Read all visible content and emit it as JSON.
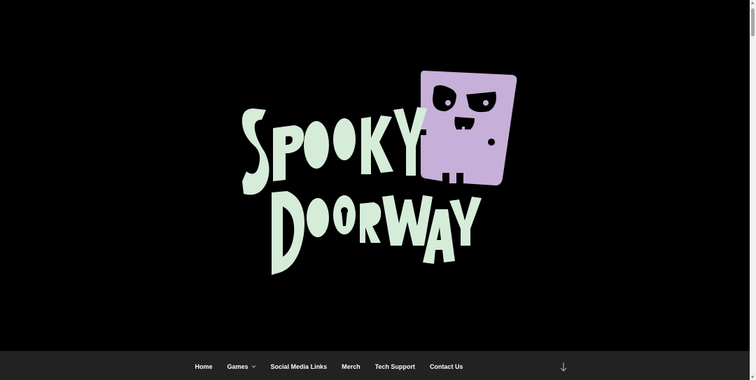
{
  "hero": {
    "logo": {
      "line1": "SPOOKY",
      "line2": "DOORWAY",
      "text_color": "#d5ecd9",
      "door_color": "#c6afd8",
      "icon": "door-skull-icon"
    }
  },
  "nav": {
    "items": [
      {
        "label": "Home"
      },
      {
        "label": "Games",
        "has_submenu": true
      },
      {
        "label": "Social Media Links"
      },
      {
        "label": "Merch"
      },
      {
        "label": "Tech Support"
      },
      {
        "label": "Contact Us"
      }
    ],
    "scroll_icon": "arrow-down-icon",
    "submenu_icon": "chevron-down-icon"
  },
  "colors": {
    "background": "#000000",
    "nav_background": "#222222",
    "nav_text": "#ffffff"
  }
}
